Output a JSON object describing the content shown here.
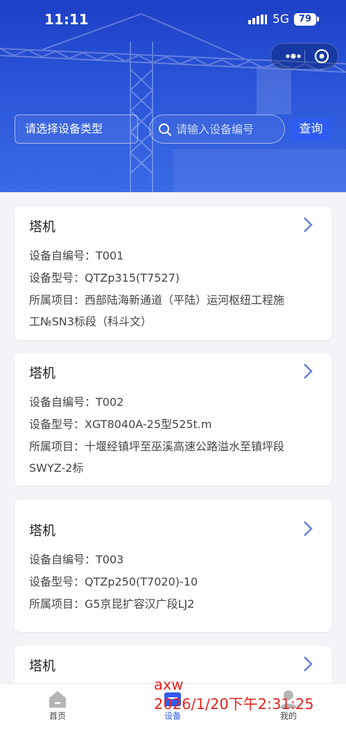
{
  "status_bar": {
    "time": "11:11",
    "network": "5G",
    "battery": "79"
  },
  "capsule": {
    "more_icon": "more-dots-icon",
    "close_icon": "target-icon"
  },
  "filters": {
    "type_placeholder": "请选择设备类型",
    "search_placeholder": "请输入设备编号",
    "query_label": "查询"
  },
  "devices": [
    {
      "type": "塔机",
      "code_line": "设备自编号：T001",
      "model_line": "设备型号：QTZp315(T7527)",
      "project_line1": "所属项目：西部陆海新通道（平陆）运河枢纽工程施",
      "project_line2": "工№SN3标段（科斗文）"
    },
    {
      "type": "塔机",
      "code_line": "设备自编号：T002",
      "model_line": "设备型号：XGT8040A-25型525t.m",
      "project_line1": "所属项目：十堰经镇坪至巫溪高速公路溢水至镇坪段",
      "project_line2": "SWYZ-2标"
    },
    {
      "type": "塔机",
      "code_line": "设备自编号：T003",
      "model_line": "设备型号：QTZp250(T7020)-10",
      "project_line1": "所属项目：G5京昆扩容汉广段LJ2",
      "project_line2": ""
    },
    {
      "type": "塔机"
    }
  ],
  "tabbar": {
    "items": [
      {
        "label": "首页",
        "icon": "home-icon"
      },
      {
        "label": "设备",
        "icon": "device-icon"
      },
      {
        "label": "我的",
        "icon": "user-icon"
      }
    ],
    "active": "设备"
  },
  "watermark": {
    "user": "axw",
    "timestamp": "2026/1/20下午2:31:25"
  },
  "colors": {
    "header": "#1d3fc6",
    "accent": "#2f5cf0",
    "watermark": "#e8231f"
  }
}
